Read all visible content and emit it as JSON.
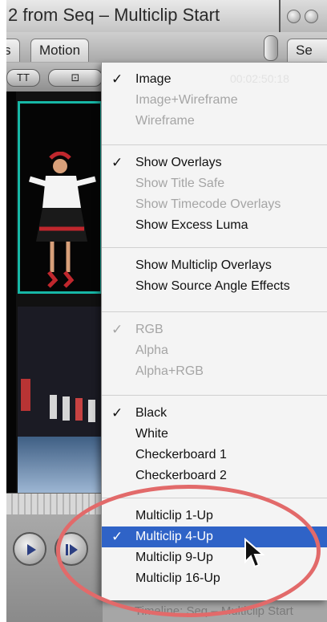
{
  "window": {
    "title": "2 from  Seq – Multiclip Start",
    "tabs": [
      {
        "label": "s"
      },
      {
        "label": "Motion"
      },
      {
        "label": "Se"
      }
    ]
  },
  "controls": {
    "view_pill": "TT",
    "overlay_pill": "⊡"
  },
  "menu": {
    "background_text": "00:02:50:18",
    "groups": [
      [
        {
          "label": "Image",
          "checked": true,
          "enabled": true
        },
        {
          "label": "Image+Wireframe",
          "checked": false,
          "enabled": false
        },
        {
          "label": "Wireframe",
          "checked": false,
          "enabled": false
        }
      ],
      [
        {
          "label": "Show Overlays",
          "checked": true,
          "enabled": true
        },
        {
          "label": "Show Title Safe",
          "checked": false,
          "enabled": false
        },
        {
          "label": "Show Timecode Overlays",
          "checked": false,
          "enabled": false
        },
        {
          "label": "Show Excess Luma",
          "checked": false,
          "enabled": true
        }
      ],
      [
        {
          "label": "Show Multiclip Overlays",
          "checked": false,
          "enabled": true
        },
        {
          "label": "Show Source Angle Effects",
          "checked": false,
          "enabled": true
        }
      ],
      [
        {
          "label": "RGB",
          "checked": true,
          "enabled": false
        },
        {
          "label": "Alpha",
          "checked": false,
          "enabled": false
        },
        {
          "label": "Alpha+RGB",
          "checked": false,
          "enabled": false
        }
      ],
      [
        {
          "label": "Black",
          "checked": true,
          "enabled": true
        },
        {
          "label": "White",
          "checked": false,
          "enabled": true
        },
        {
          "label": "Checkerboard 1",
          "checked": false,
          "enabled": true
        },
        {
          "label": "Checkerboard 2",
          "checked": false,
          "enabled": true
        }
      ],
      [
        {
          "label": "Multiclip 1-Up",
          "checked": false,
          "enabled": true
        },
        {
          "label": "Multiclip 4-Up",
          "checked": true,
          "enabled": true,
          "selected": true
        },
        {
          "label": "Multiclip 9-Up",
          "checked": false,
          "enabled": true
        },
        {
          "label": "Multiclip 16-Up",
          "checked": false,
          "enabled": true
        }
      ]
    ]
  },
  "bottom_bar": {
    "text": "Timeline: Seq – Multiclip Start"
  },
  "icons": {
    "check": "checkmark-icon",
    "play": "play-icon",
    "play_in_out": "play-in-out-icon",
    "cursor": "arrow-cursor-icon"
  },
  "colors": {
    "selection": "#2f63c7",
    "angle_highlight": "#17b7a6",
    "annotation": "#e26a6a"
  }
}
